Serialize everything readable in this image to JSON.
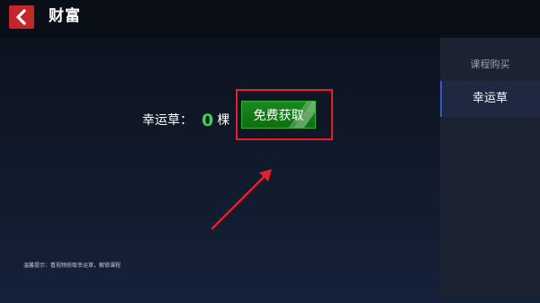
{
  "header": {
    "back_icon": "chevron-left-icon",
    "title": "财富"
  },
  "main": {
    "clover_label": "幸运草：",
    "clover_count": "0",
    "clover_unit": "棵",
    "free_button_label": "免费获取",
    "tip": "温馨提示：看视频获取幸运草，解锁课程"
  },
  "sidebar": {
    "items": [
      {
        "label": "课程购买"
      },
      {
        "label": "幸运草"
      }
    ],
    "selected_index": 1
  },
  "colors": {
    "accent_red": "#c4262b",
    "button_green": "#1a8a1e",
    "count_green": "#3fd04a",
    "annotation_red": "#e3202c"
  }
}
